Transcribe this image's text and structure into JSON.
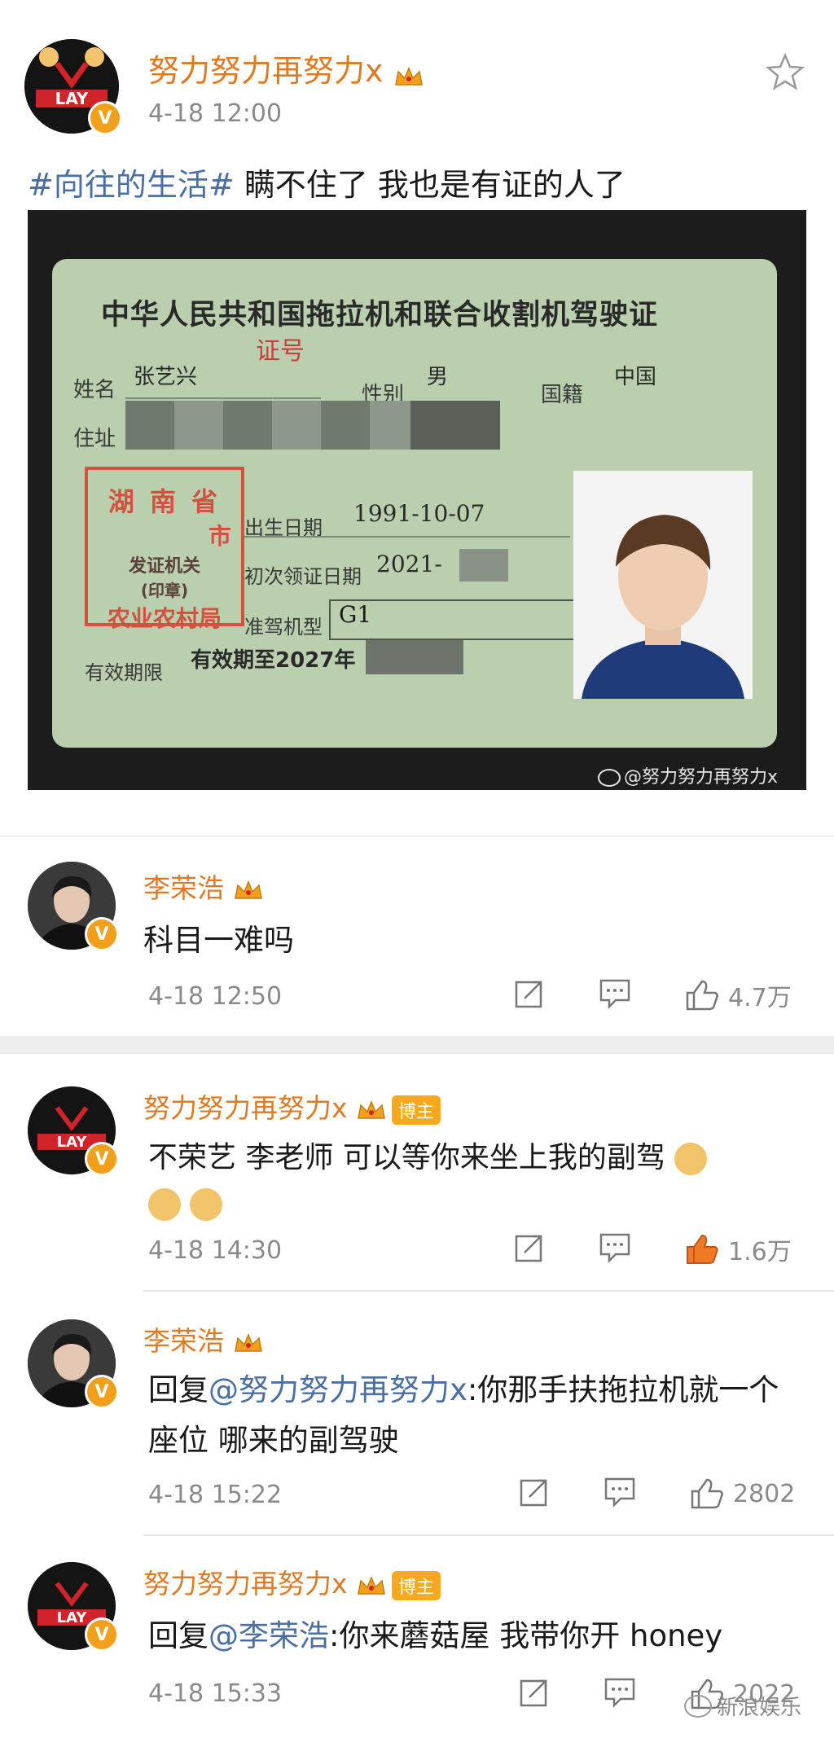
{
  "post": {
    "author": "努力努力再努力x",
    "time": "4-18 12:00",
    "hashtag": "#向往的生活#",
    "text": " 瞒不住了 我也是有证的人了",
    "license": {
      "title": "中华人民共和国拖拉机和联合收割机驾驶证",
      "cert_no_label": "证号",
      "name_label": "姓名",
      "name_value": "张艺兴",
      "sex_label": "性别",
      "sex_value": "男",
      "nation_label": "国籍",
      "nation_value": "中国",
      "addr_label": "住址",
      "seal_line1": "湖 南 省",
      "seal_line2": "市",
      "seal_line3": "发证机关",
      "seal_line4": "(印章)",
      "seal_line5": "农业农村局",
      "dob_label": "出生日期",
      "dob_value": "1991-10-07",
      "first_label": "初次领证日期",
      "first_value": "2021-",
      "type_label": "准驾机型",
      "type_value": "G1",
      "valid_label": "有效期限",
      "valid_value": "有效期至2027年",
      "watermark": "@努力努力再努力x"
    }
  },
  "comments": [
    {
      "author": "李荣浩",
      "text": "科目一难吗",
      "time": "4-18 12:50",
      "likes": "4.7万",
      "liked": false,
      "bozhu": ""
    },
    {
      "author": "努力努力再努力x",
      "text": "不荣艺  李老师 可以等你来坐上我的副驾",
      "time": "4-18 14:30",
      "likes": "1.6万",
      "liked": true,
      "bozhu": "博主"
    },
    {
      "author": "李荣浩",
      "reply_prefix": "回复",
      "mention": "@努力努力再努力x",
      "text": ":你那手扶拖拉机就一个座位 哪来的副驾驶",
      "time": "4-18 15:22",
      "likes": "2802",
      "liked": false,
      "bozhu": ""
    },
    {
      "author": "努力努力再努力x",
      "reply_prefix": "回复",
      "mention": "@李荣浩",
      "text": ":你来蘑菇屋 我带你开 honey",
      "time": "4-18 15:33",
      "likes": "2022",
      "liked": false,
      "bozhu": "博主"
    }
  ],
  "footer_watermark": "新浪娱乐",
  "colors": {
    "accent_orange": "#e07a22",
    "hashtag_blue": "#4a6fa5",
    "liked_orange": "#f07a23",
    "meta_gray": "#8a8a8a"
  }
}
